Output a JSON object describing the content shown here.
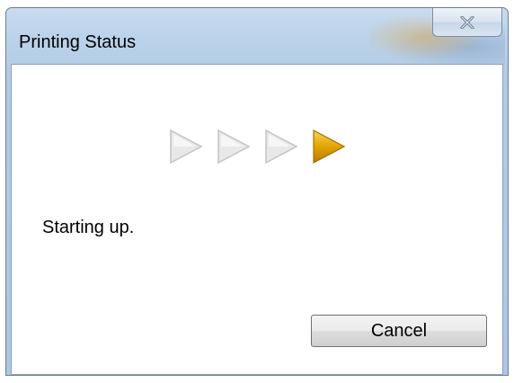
{
  "window": {
    "title": "Printing Status",
    "close_icon": "close-icon"
  },
  "progress": {
    "steps": [
      {
        "icon": "triangle-right-icon",
        "state": "inactive",
        "color": "#e6e6e6"
      },
      {
        "icon": "triangle-right-icon",
        "state": "inactive",
        "color": "#e6e6e6"
      },
      {
        "icon": "triangle-right-icon",
        "state": "inactive",
        "color": "#e6e6e6"
      },
      {
        "icon": "triangle-right-icon",
        "state": "active",
        "color": "#d99a00"
      }
    ]
  },
  "status": {
    "message": "Starting up."
  },
  "buttons": {
    "cancel_label": "Cancel"
  }
}
